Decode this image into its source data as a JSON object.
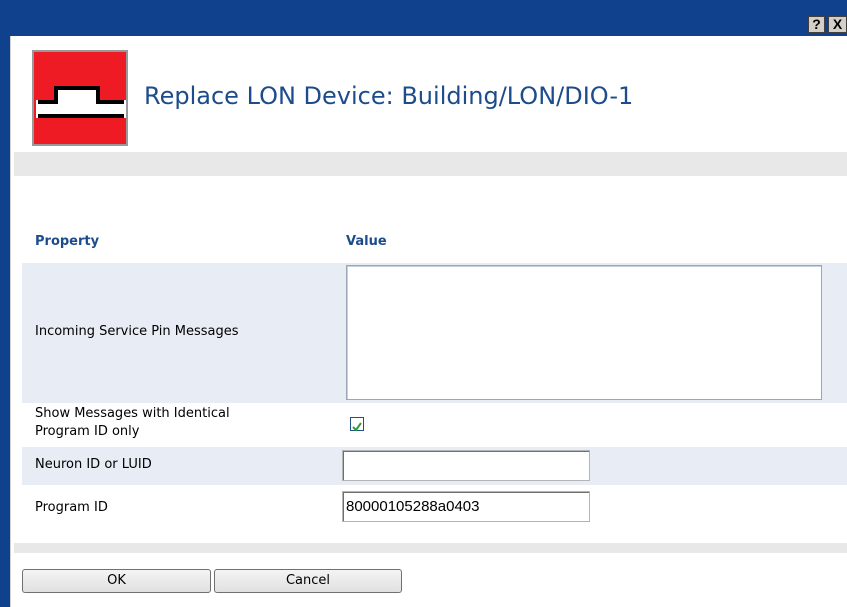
{
  "window": {
    "help_glyph": "?",
    "close_glyph": "X"
  },
  "header": {
    "title": "Replace LON Device: Building/LON/DIO-1",
    "icon": "lon-device-icon"
  },
  "table": {
    "col_property": "Property",
    "col_value": "Value",
    "rows": [
      {
        "label": "Incoming Service Pin Messages",
        "value": ""
      },
      {
        "label_line1": "Show Messages with Identical",
        "label_line2": "Program ID only",
        "checked": true
      },
      {
        "label": "Neuron ID or LUID",
        "value": ""
      },
      {
        "label": "Program ID",
        "value": "80000105288a0403"
      }
    ]
  },
  "buttons": {
    "ok": "OK",
    "cancel": "Cancel"
  },
  "colors": {
    "titlebar": "#10418c",
    "title_text": "#1c4c8c",
    "icon_bg": "#ee1b24",
    "check": "#2e9e2e"
  }
}
